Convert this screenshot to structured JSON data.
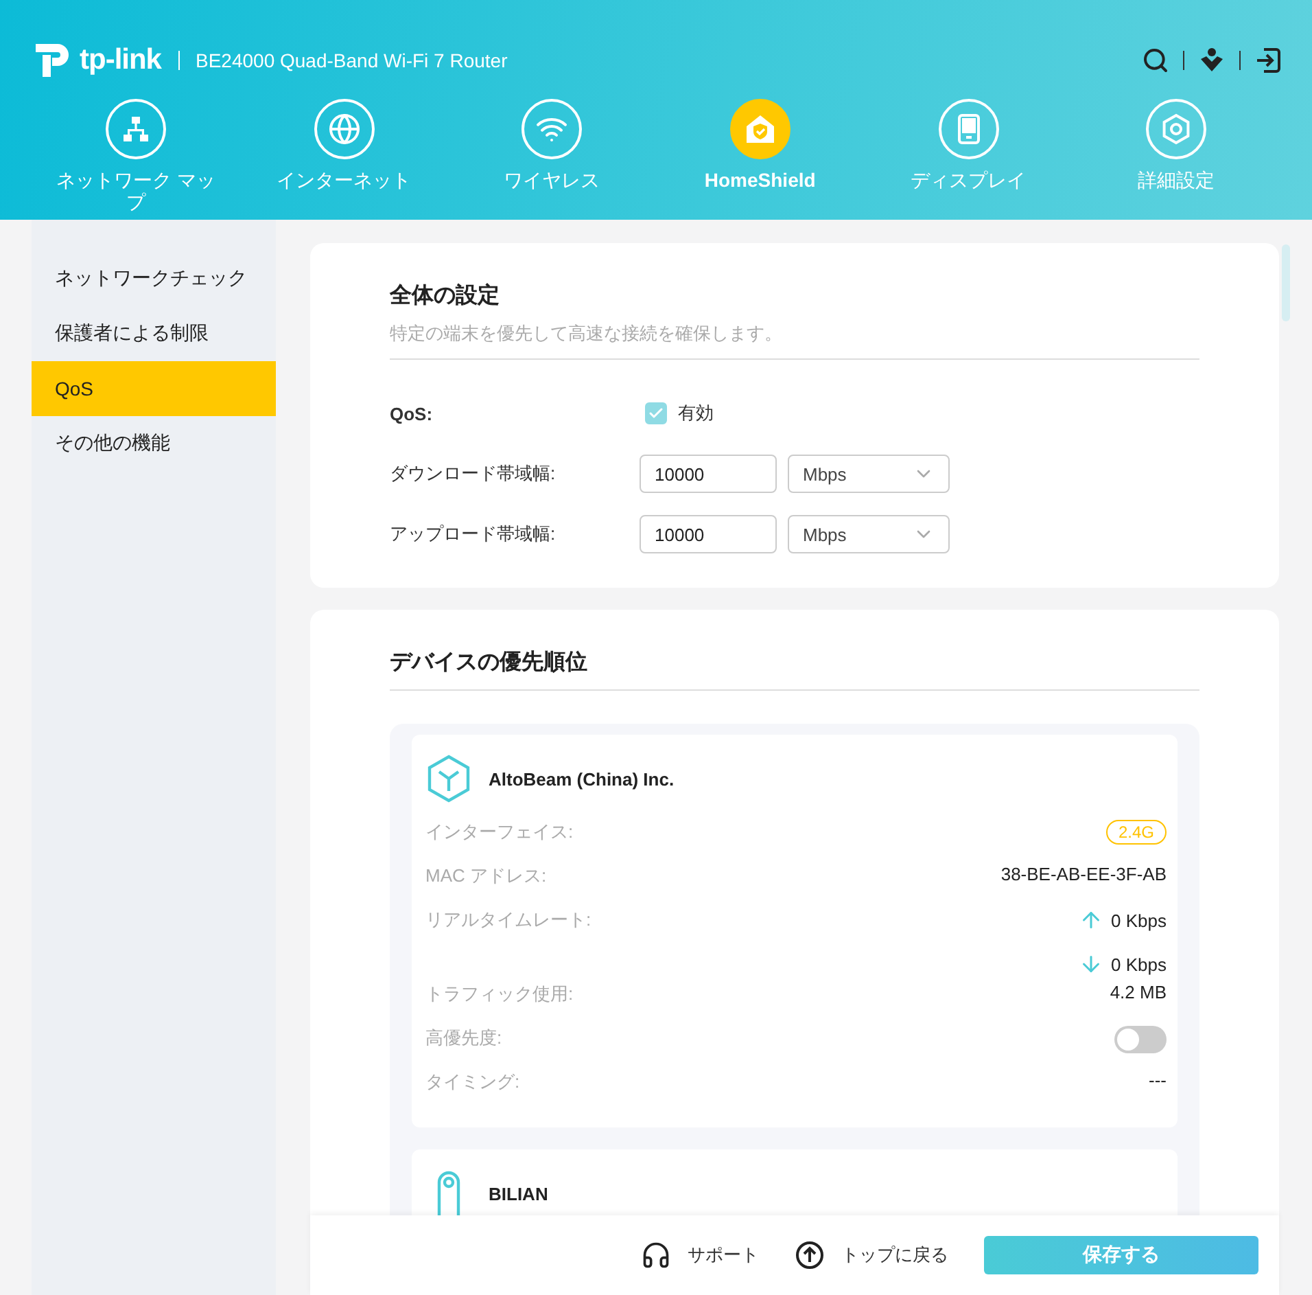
{
  "header": {
    "logo": "tp-link",
    "model": "BE24000 Quad-Band Wi-Fi 7 Router"
  },
  "nav": [
    {
      "label": "ネットワーク マップ",
      "selected": false
    },
    {
      "label": "インターネット",
      "selected": false
    },
    {
      "label": "ワイヤレス",
      "selected": false
    },
    {
      "label": "HomeShield",
      "selected": true
    },
    {
      "label": "ディスプレイ",
      "selected": false
    },
    {
      "label": "詳細設定",
      "selected": false
    }
  ],
  "sidebar": [
    {
      "label": "ネットワークチェック",
      "selected": false
    },
    {
      "label": "保護者による制限",
      "selected": false
    },
    {
      "label": "QoS",
      "selected": true
    },
    {
      "label": "その他の機能",
      "selected": false
    }
  ],
  "general": {
    "title": "全体の設定",
    "description": "特定の端末を優先して高速な接続を確保します。",
    "qos_label": "QoS:",
    "qos_option": "有効",
    "qos_checked": true,
    "bandwidth": [
      {
        "label": "ダウンロード帯域幅:",
        "value": "10000",
        "unit": "Mbps"
      },
      {
        "label": "アップロード帯域幅:",
        "value": "10000",
        "unit": "Mbps"
      }
    ]
  },
  "priority": {
    "title": "デバイスの優先順位",
    "devices": [
      {
        "name": "AltoBeam (China) Inc.",
        "rows": [
          {
            "kind": "badge",
            "label": "インターフェイス:",
            "value": "2.4G"
          },
          {
            "kind": "text",
            "label": "MAC アドレス:",
            "value": "38-BE-AB-EE-3F-AB"
          },
          {
            "kind": "rate",
            "label": "リアルタイムレート:",
            "up": "0 Kbps",
            "down": "0 Kbps"
          },
          {
            "kind": "text",
            "label": "トラフィック使用:",
            "value": "4.2 MB"
          },
          {
            "kind": "toggle",
            "label": "高優先度:",
            "on": false
          },
          {
            "kind": "text",
            "label": "タイミング:",
            "value": "---"
          }
        ]
      },
      {
        "name": "BILIAN"
      }
    ]
  },
  "footer": {
    "support": "サポート",
    "top": "トップに戻る",
    "save": "保存する"
  }
}
